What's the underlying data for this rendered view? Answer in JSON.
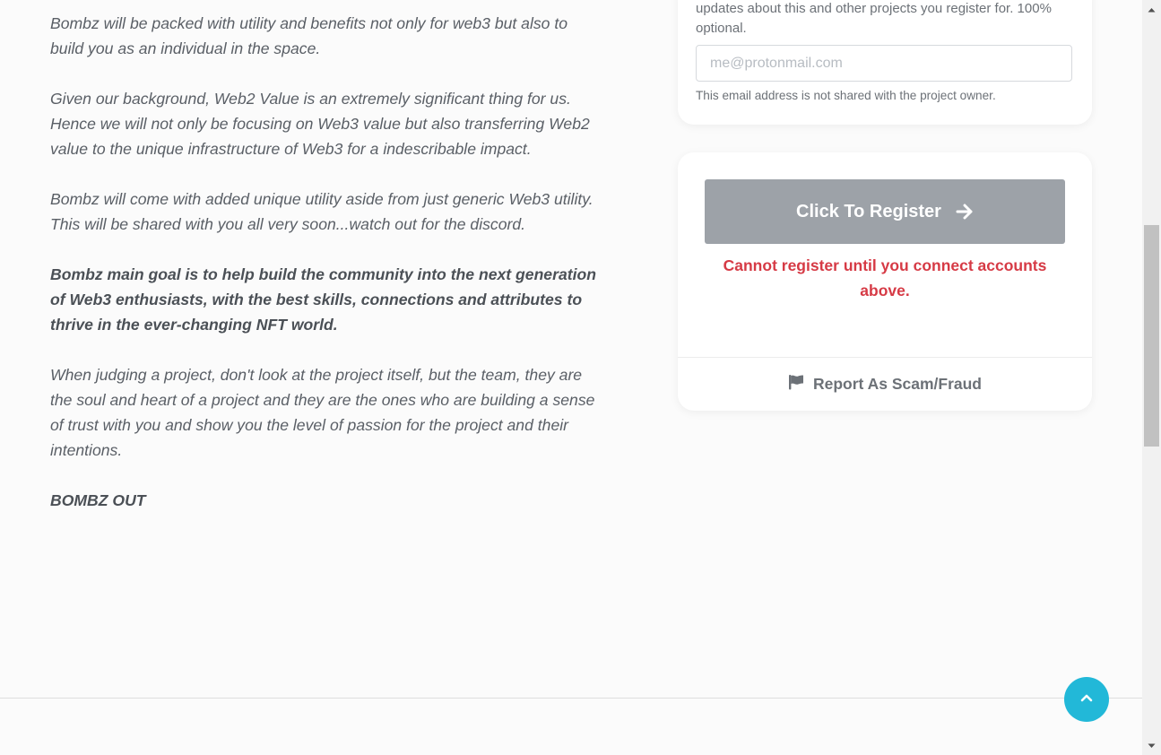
{
  "article": {
    "paragraphs": [
      {
        "text": "Bombz will be packed with utility and benefits not only for web3 but also to build you as an individual in the space.",
        "bold": false
      },
      {
        "text": "Given our background, Web2 Value is an extremely significant thing for us. Hence we will not only be focusing on Web3 value but also transferring Web2 value to the unique infrastructure of Web3 for a indescribable impact.",
        "bold": false
      },
      {
        "text": "Bombz will come with added unique utility aside from just generic Web3 utility. This will be shared with you all very soon...watch out for the discord.",
        "bold": false
      },
      {
        "text": "Bombz main goal is to help build the community into the next generation of Web3 enthusiasts, with the best skills, connections and attributes to thrive in the ever-changing NFT world.",
        "bold": true
      },
      {
        "text": "When judging a project, don't look at the project itself, but the team, they are the soul and heart of a project and they are the ones who are building a sense of trust with you and show you the level of passion for the project and their intentions.",
        "bold": false
      },
      {
        "text": "BOMBZ OUT",
        "bold": true
      }
    ]
  },
  "email_card": {
    "intro": "updates about this and other projects you register for. 100% optional.",
    "placeholder": "me@protonmail.com",
    "value": "",
    "hint": "This email address is not shared with the project owner."
  },
  "register_card": {
    "button_label": "Click To Register",
    "button_icon": "arrow-right-icon",
    "error": "Cannot register until you connect accounts above.",
    "report_label": "Report As Scam/Fraud",
    "report_icon": "flag-icon"
  },
  "scroll_top": {
    "icon": "chevron-up-icon"
  },
  "scrollbar": {
    "position_fraction": 0.3
  },
  "colors": {
    "button_disabled": "#9da2a8",
    "error": "#d63a45",
    "scroll_top_bg": "#22b8d8",
    "text": "#5a5f66"
  }
}
